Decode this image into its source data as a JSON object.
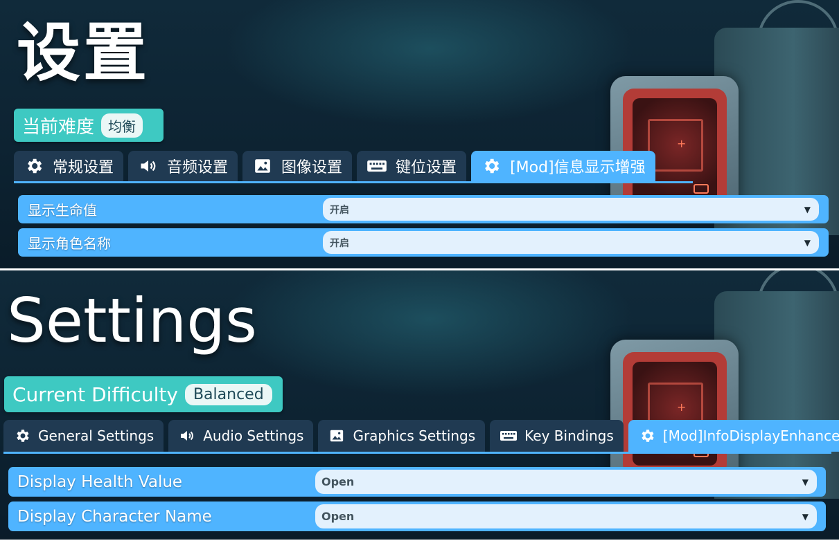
{
  "zh": {
    "title": "设置",
    "difficulty": {
      "label": "当前难度",
      "value": "均衡"
    },
    "tabs": [
      {
        "label": "常规设置",
        "icon": "gear-icon"
      },
      {
        "label": "音频设置",
        "icon": "speaker-icon"
      },
      {
        "label": "图像设置",
        "icon": "image-icon"
      },
      {
        "label": "键位设置",
        "icon": "keyboard-icon"
      },
      {
        "label": "[Mod]信息显示增强",
        "icon": "gear-icon",
        "active": true
      }
    ],
    "options": [
      {
        "label": "显示生命值",
        "value": "开启"
      },
      {
        "label": "显示角色名称",
        "value": "开启"
      }
    ]
  },
  "en": {
    "title": "Settings",
    "difficulty": {
      "label": "Current Difficulty",
      "value": "Balanced"
    },
    "tabs": [
      {
        "label": "General Settings",
        "icon": "gear-icon"
      },
      {
        "label": "Audio Settings",
        "icon": "speaker-icon"
      },
      {
        "label": "Graphics Settings",
        "icon": "image-icon"
      },
      {
        "label": "Key Bindings",
        "icon": "keyboard-icon"
      },
      {
        "label": "[Mod]InfoDisplayEnhancement",
        "icon": "gear-icon",
        "active": true
      }
    ],
    "options": [
      {
        "label": "Display Health Value",
        "value": "Open"
      },
      {
        "label": "Display Character Name",
        "value": "Open"
      }
    ]
  },
  "colors": {
    "accent_blue": "#4fb4ff",
    "teal_badge": "#3ec9c2",
    "tab_inactive": "#203a52",
    "background": "#0d2332"
  }
}
